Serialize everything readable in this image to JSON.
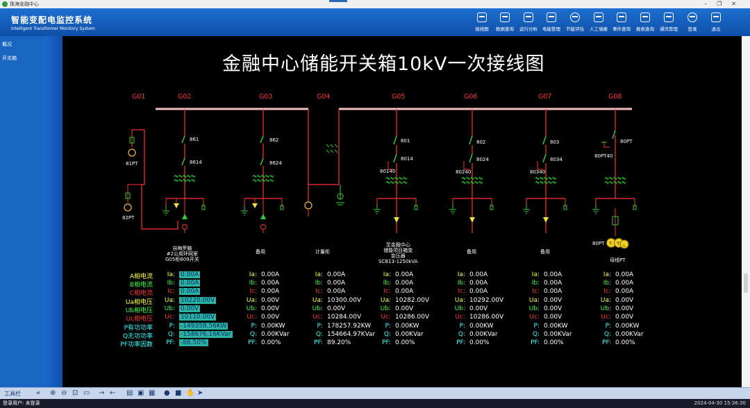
{
  "window": {
    "title": "珠海金融中心"
  },
  "header": {
    "title": "智能变配电监控系统",
    "subtitle": "Intelligent Transformer Monitory System",
    "nav": [
      {
        "label": "接线图",
        "icon": "diagram-icon"
      },
      {
        "label": "数据查询",
        "icon": "data-query-icon"
      },
      {
        "label": "运行分析",
        "icon": "analysis-icon"
      },
      {
        "label": "电能管理",
        "icon": "energy-icon"
      },
      {
        "label": "节能评估",
        "icon": "eco-icon"
      },
      {
        "label": "人工填报",
        "icon": "manual-entry-icon"
      },
      {
        "label": "事件查询",
        "icon": "event-icon"
      },
      {
        "label": "报表查询",
        "icon": "report-icon"
      },
      {
        "label": "通讯管理",
        "icon": "comm-icon"
      },
      {
        "label": "登录",
        "icon": "user-icon"
      },
      {
        "label": "退出",
        "icon": "exit-icon"
      }
    ]
  },
  "sidebar": {
    "items": [
      {
        "label": "概况"
      },
      {
        "label": "开关箱"
      }
    ]
  },
  "diagram": {
    "title": "金融中心储能开关箱10kV一次接线图",
    "cabinets": [
      "G01",
      "G02",
      "G03",
      "G04",
      "G05",
      "G06",
      "G07",
      "G08"
    ],
    "device_labels": {
      "g01_pt1": "81PT",
      "g01_pt2": "82PT",
      "g02_upper": "861",
      "g02_lower": "8614",
      "g03_upper": "862",
      "g03_lower": "8624",
      "g05_upper": "801",
      "g05_lower": "8014",
      "g05_earth": "80140",
      "g06_upper": "802",
      "g06_lower": "8024",
      "g06_earth": "80240",
      "g07_upper": "803",
      "g07_lower": "8034",
      "g07_earth": "80340",
      "g08_upper": "80PT",
      "g08_earth": "80PT40",
      "g08_pt": "80PT"
    },
    "feeder_titles": {
      "g02": [
        "自梅罗脑",
        "#2公用环网室",
        "G05柜609开关"
      ],
      "g03": [
        "备用"
      ],
      "g04": [
        "计量柜"
      ],
      "g05": [
        "至金融中心",
        "储能项目箱变",
        "变压器",
        "SCB13-1250kVA"
      ],
      "g06": [
        "备用"
      ],
      "g07": [
        "备用"
      ],
      "g08": [
        "母线PT"
      ]
    }
  },
  "measurements": {
    "labels": [
      "A相电流",
      "B相电流",
      "C相电流",
      "Ua相电压",
      "Ub相电压",
      "Uc相电压",
      "P有功功率",
      "Q无功功率",
      "PF功率因数"
    ],
    "label_colors": [
      "#ffff33",
      "#33ff33",
      "#ff3333",
      "#ffff33",
      "#33ff33",
      "#ff3333",
      "#33ffff",
      "#33ffff",
      "#33ffff"
    ],
    "short": [
      "Ia:",
      "Ib:",
      "Ic:",
      "Ua:",
      "Ub:",
      "Uc:",
      "P:",
      "Q:",
      "PF:"
    ],
    "columns": [
      {
        "id": "g02",
        "values": [
          "0.00A",
          "0.00A",
          "0.00A",
          "10220.00V",
          "0.00V",
          "10110.00V",
          "-149358.56KW",
          "-158676.16KVar",
          "-86.50%"
        ],
        "highlight": true
      },
      {
        "id": "g03",
        "values": [
          "0.00A",
          "0.00A",
          "0.00A",
          "0.00V",
          "0.00V",
          "0.00V",
          "0.00KW",
          "0.00KVar",
          "0.00%"
        ]
      },
      {
        "id": "g04",
        "values": [
          "0.00A",
          "0.00A",
          "0.00A",
          "10300.00V",
          "0.00V",
          "10284.00V",
          "178257.92KW",
          "154664.97KVar",
          "89.20%"
        ]
      },
      {
        "id": "g05",
        "values": [
          "0.00A",
          "0.00A",
          "0.00A",
          "10282.00V",
          "0.00V",
          "10286.00V",
          "0.00KW",
          "0.00KVar",
          "0.00%"
        ]
      },
      {
        "id": "g06",
        "values": [
          "0.00A",
          "0.00A",
          "0.00A",
          "10292.00V",
          "0.00V",
          "10286.00V",
          "0.00KW",
          "0.00KVar",
          "0.00%"
        ]
      },
      {
        "id": "g07",
        "values": [
          "0.00A",
          "0.00A",
          "0.00A",
          "0.00V",
          "0.00V",
          "0.00V",
          "0.00KW",
          "0.00KVar",
          "0.00%"
        ]
      },
      {
        "id": "g08",
        "values": [
          "0.00A",
          "0.00A",
          "0.00A",
          "0.00V",
          "0.00V",
          "0.00V",
          "0.00KW",
          "0.00KVar",
          "0.00%"
        ]
      }
    ]
  },
  "toolbar": {
    "label": "工具栏"
  },
  "statusbar": {
    "user": "登录用户: 未登录",
    "time": "2024-04-30  15:36:30"
  }
}
